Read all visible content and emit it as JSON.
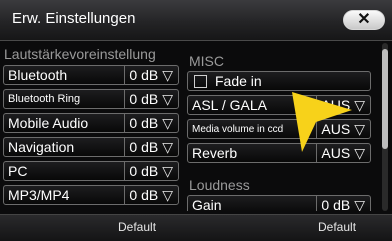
{
  "title": "Erw. Einstellungen",
  "close_symbol": "✕",
  "left_panel": {
    "header": "Lautstärkevoreinstellung",
    "rows": [
      {
        "name": "Bluetooth",
        "value": "0 dB"
      },
      {
        "name": "Bluetooth Ring",
        "value": "0 dB"
      },
      {
        "name": "Mobile Audio",
        "value": "0 dB"
      },
      {
        "name": "Navigation",
        "value": "0 dB"
      },
      {
        "name": "PC",
        "value": "0 dB"
      },
      {
        "name": "MP3/MP4",
        "value": "0 dB"
      }
    ]
  },
  "right_panel": {
    "misc_header": "MISC",
    "fade_in_label": "Fade in",
    "rows": [
      {
        "name": "ASL / GALA",
        "value": "AUS"
      },
      {
        "name": "Media volume in ccd",
        "value": "AUS"
      },
      {
        "name": "Reverb",
        "value": "AUS"
      }
    ],
    "loudness_header": "Loudness",
    "gain_row": {
      "name": "Gain",
      "value": "0 dB"
    }
  },
  "dropdown_arrow": "▽",
  "bottom": {
    "left_default": "Default",
    "right_default": "Default"
  },
  "colors": {
    "cursor_yellow": "#f7d21a"
  }
}
